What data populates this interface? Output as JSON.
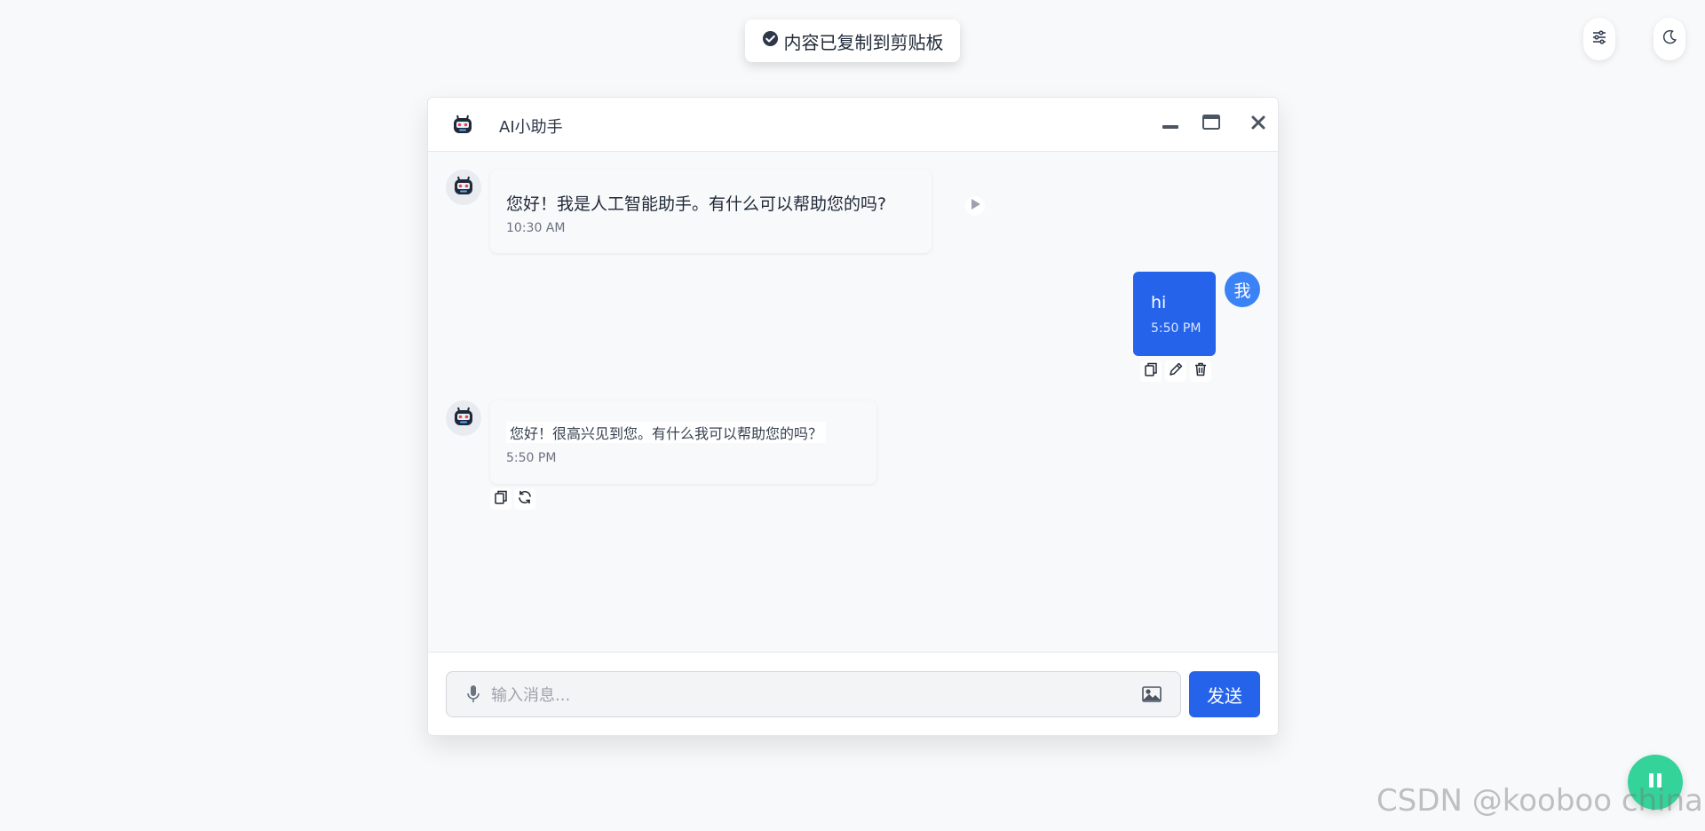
{
  "toast": {
    "message": "内容已复制到剪贴板",
    "icon": "check-circle-icon"
  },
  "top_controls": {
    "settings_icon": "sliders-icon",
    "theme_icon": "moon-icon"
  },
  "chat": {
    "title": "AI小助手",
    "window_controls": {
      "minimize_icon": "minimize-icon",
      "maximize_icon": "maximize-icon",
      "close_icon": "close-icon"
    },
    "messages": [
      {
        "role": "assistant",
        "text": "您好！我是人工智能助手。有什么可以帮助您的吗?",
        "time": "10:30 AM",
        "action_icon": "play-icon"
      },
      {
        "role": "user",
        "avatar_label": "我",
        "text": "hi",
        "time": "5:50 PM",
        "actions": [
          "copy-icon",
          "edit-icon",
          "trash-icon"
        ]
      },
      {
        "role": "assistant",
        "text": "您好！很高兴见到您。有什么我可以帮助您的吗？",
        "time": "5:50 PM",
        "actions": [
          "copy-icon",
          "refresh-icon"
        ]
      }
    ],
    "input": {
      "placeholder": "输入消息...",
      "value": "",
      "mic_icon": "microphone-icon",
      "image_icon": "image-icon"
    },
    "send_label": "发送"
  },
  "floating_button": {
    "icon": "pause-icon"
  },
  "watermark": "CSDN @kooboo china.",
  "colors": {
    "accent": "#2563eb",
    "float_button": "#34d399",
    "background": "#f8f9fb"
  }
}
